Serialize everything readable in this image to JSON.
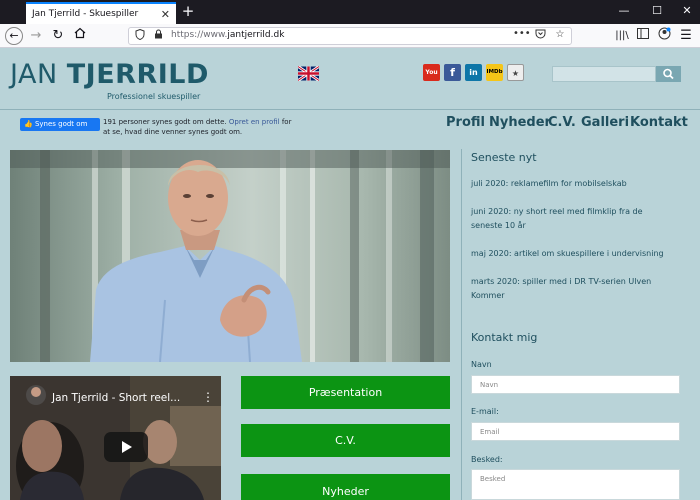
{
  "browser": {
    "tab_title": "Jan Tjerrild - Skuespiller",
    "url_prefix": "https://www.",
    "url_domain": "jantjerrild.dk",
    "url_dots": "•••"
  },
  "header": {
    "logo_first": "JAN ",
    "logo_last": "TJERRILD",
    "logo_subtitle": "Professionel skuespiller",
    "social": [
      "youtube-icon",
      "facebook-icon",
      "linkedin-icon",
      "imdb-icon",
      "award-icon"
    ],
    "social_labels": [
      "You",
      "f",
      "in",
      "IMDb",
      "★"
    ]
  },
  "facebook": {
    "like_label": "👍 Synes godt om",
    "text_before": "191 personer synes godt om dette. ",
    "link": "Opret en profil",
    "text_after": " for at se, hvad dine venner synes godt om."
  },
  "nav": [
    "Profil",
    "Nyheder",
    "C.V.",
    "Galleri",
    "Kontakt"
  ],
  "video": {
    "title": "Jan Tjerrild - Short reel..."
  },
  "buttons": [
    "Præsentation",
    "C.V.",
    "Nyheder"
  ],
  "sidebar": {
    "news_heading": "Seneste nyt",
    "news": [
      "juli 2020: reklamefilm for mobilselskab",
      "juni 2020: ny short reel med filmklip fra de seneste 10 år",
      "maj 2020: artikel om skuespillere i undervisning",
      "marts 2020: spiller med i DR TV-serien Ulven Kommer"
    ],
    "contact_heading": "Kontakt mig",
    "fields": [
      {
        "label": "Navn",
        "placeholder": "Navn"
      },
      {
        "label": "E-mail:",
        "placeholder": "Email"
      },
      {
        "label": "Besked:",
        "placeholder": "Besked"
      }
    ]
  },
  "colors": {
    "accent_green": "#0c9413",
    "brand_teal": "#1f5a6a",
    "page_bg": "#b9d3d8"
  }
}
